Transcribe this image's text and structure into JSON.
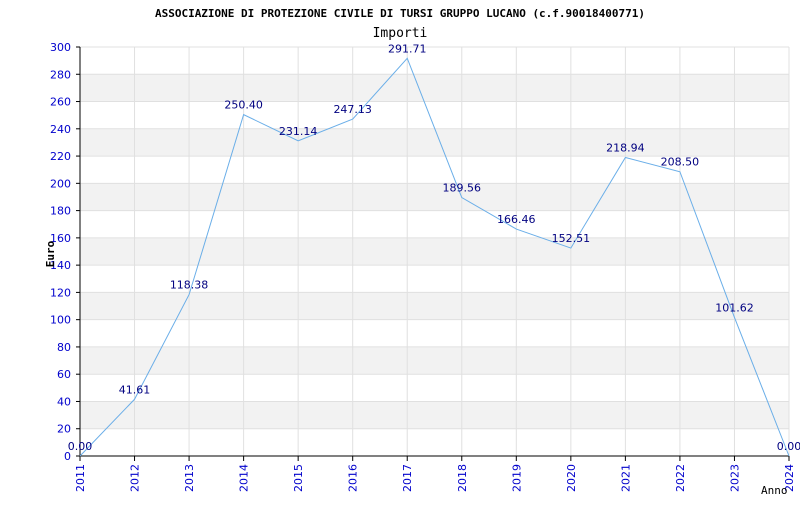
{
  "chart_data": {
    "type": "line",
    "title": "ASSOCIAZIONE DI PROTEZIONE CIVILE DI TURSI GRUPPO LUCANO (c.f.90018400771)",
    "subtitle": "Importi",
    "xlabel": "Anno",
    "ylabel": "Euro",
    "x": [
      "2011",
      "2012",
      "2013",
      "2014",
      "2015",
      "2016",
      "2017",
      "2018",
      "2019",
      "2020",
      "2021",
      "2022",
      "2023",
      "2024"
    ],
    "values": [
      0.0,
      41.61,
      118.38,
      250.4,
      231.14,
      247.13,
      291.71,
      189.56,
      166.46,
      152.51,
      218.94,
      208.5,
      101.62,
      0.0
    ],
    "data_labels": [
      "0.00",
      "41.61",
      "118.38",
      "250.40",
      "231.14",
      "247.13",
      "291.71",
      "189.56",
      "166.46",
      "152.51",
      "218.94",
      "208.50",
      "101.62",
      "0.00"
    ],
    "ylim": [
      0,
      300
    ],
    "yticks": [
      0,
      20,
      40,
      60,
      80,
      100,
      120,
      140,
      160,
      180,
      200,
      220,
      240,
      260,
      280,
      300
    ],
    "grid": true,
    "line_color": "#6aaee8",
    "band_color": "#f2f2f2",
    "grid_color": "#e0e0e0",
    "tick_color": "#0000cc",
    "label_color": "#000080"
  }
}
